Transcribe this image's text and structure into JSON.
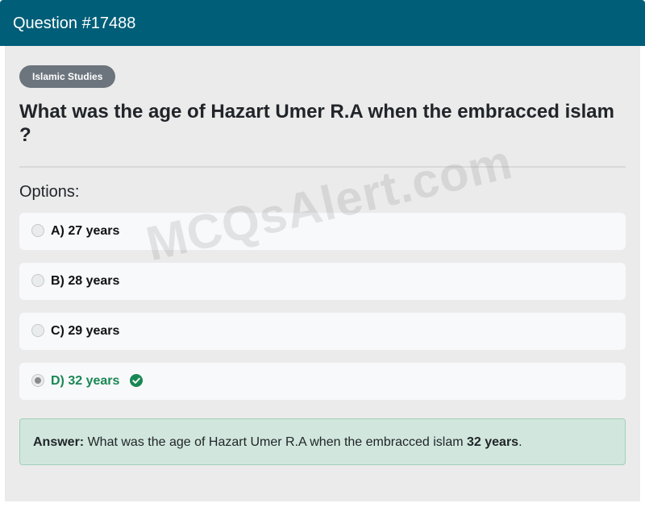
{
  "header": {
    "title": "Question #17488"
  },
  "category_badge": "Islamic Studies",
  "question": "What was the age of Hazart Umer R.A when the embracced islam ?",
  "options_label": "Options:",
  "options": [
    {
      "label": "A) 27 years",
      "selected": false,
      "correct": false
    },
    {
      "label": "B) 28 years",
      "selected": false,
      "correct": false
    },
    {
      "label": "C) 29 years",
      "selected": false,
      "correct": false
    },
    {
      "label": "D) 32 years",
      "selected": true,
      "correct": true
    }
  ],
  "watermark": "MCQsAlert.com",
  "answer": {
    "prefix": "Answer:",
    "text": "What was the age of Hazart Umer R.A when the embracced islam",
    "value": "32 years",
    "suffix": "."
  },
  "colors": {
    "header": "#005e78",
    "badge": "#6c757d",
    "correct": "#198754",
    "answer_bg": "#d1e7dd"
  },
  "icons": {
    "correct": "check-circle-icon"
  }
}
